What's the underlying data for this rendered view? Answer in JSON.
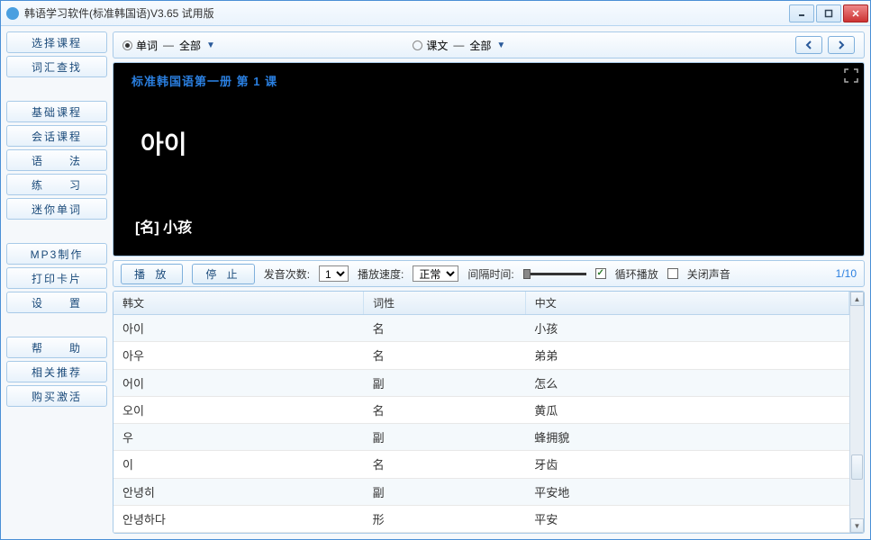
{
  "window": {
    "title": "韩语学习软件(标准韩国语)V3.65 试用版"
  },
  "sidebar": {
    "g1": [
      "选择课程",
      "词汇查找"
    ],
    "g2": [
      "基础课程",
      "会话课程",
      "语　　法",
      "练　　习",
      "迷你单词"
    ],
    "g3": [
      "MP3制作",
      "打印卡片",
      "设　　置"
    ],
    "g4": [
      "帮　　助",
      "相关推荐",
      "购买激活"
    ]
  },
  "topbar": {
    "radio1_label": "单词",
    "radio2_label": "课文",
    "all_label": "全部"
  },
  "display": {
    "lesson": "标准韩国语第一册 第 1 课",
    "word": "아이",
    "meaning": "[名] 小孩"
  },
  "controls": {
    "play": "播 放",
    "stop": "停 止",
    "count_label": "发音次数:",
    "count_value": "1",
    "speed_label": "播放速度:",
    "speed_value": "正常",
    "interval_label": "间隔时间:",
    "loop_label": "循环播放",
    "mute_label": "关闭声音",
    "counter": "1/10"
  },
  "table": {
    "headers": [
      "韩文",
      "词性",
      "中文"
    ],
    "rows": [
      [
        "아이",
        "名",
        "小孩"
      ],
      [
        "아우",
        "名",
        "弟弟"
      ],
      [
        "어이",
        "副",
        "怎么"
      ],
      [
        "오이",
        "名",
        "黄瓜"
      ],
      [
        "우",
        "副",
        "蜂拥貌"
      ],
      [
        "이",
        "名",
        "牙齿"
      ],
      [
        "안녕히",
        "副",
        "平安地"
      ],
      [
        "안녕하다",
        "形",
        "平安"
      ]
    ]
  }
}
